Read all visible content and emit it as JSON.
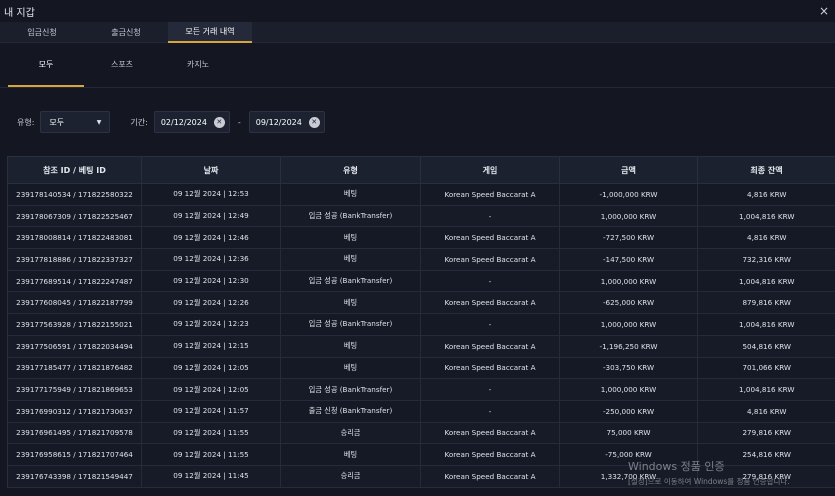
{
  "window": {
    "title": "내 지갑",
    "close": "×"
  },
  "top_tabs": [
    {
      "label": "입금신청"
    },
    {
      "label": "출금신청"
    },
    {
      "label": "모든 거래 내역"
    }
  ],
  "sub_tabs": [
    {
      "label": "모두"
    },
    {
      "label": "스포츠"
    },
    {
      "label": "카지노"
    }
  ],
  "filters": {
    "type_label": "유형:",
    "type_value": "모두",
    "period_label": "기간:",
    "date_from": "02/12/2024",
    "date_to": "09/12/2024",
    "dash": "-"
  },
  "table": {
    "columns": [
      "참조 ID / 베팅 ID",
      "날짜",
      "유형",
      "게임",
      "금액",
      "최종 잔액"
    ],
    "rows": [
      [
        "239178140534 / 171822580322",
        "09 12월 2024 | 12:53",
        "베팅",
        "Korean Speed Baccarat A",
        "-1,000,000 KRW",
        "4,816 KRW"
      ],
      [
        "239178067309 / 171822525467",
        "09 12월 2024 | 12:49",
        "입금 성공 (BankTransfer)",
        "-",
        "1,000,000 KRW",
        "1,004,816 KRW"
      ],
      [
        "239178008814 / 171822483081",
        "09 12월 2024 | 12:46",
        "베팅",
        "Korean Speed Baccarat A",
        "-727,500 KRW",
        "4,816 KRW"
      ],
      [
        "239177818886 / 171822337327",
        "09 12월 2024 | 12:36",
        "베팅",
        "Korean Speed Baccarat A",
        "-147,500 KRW",
        "732,316 KRW"
      ],
      [
        "239177689514 / 171822247487",
        "09 12월 2024 | 12:30",
        "입금 성공 (BankTransfer)",
        "-",
        "1,000,000 KRW",
        "1,004,816 KRW"
      ],
      [
        "239177608045 / 171822187799",
        "09 12월 2024 | 12:26",
        "베팅",
        "Korean Speed Baccarat A",
        "-625,000 KRW",
        "879,816 KRW"
      ],
      [
        "239177563928 / 171822155021",
        "09 12월 2024 | 12:23",
        "입금 성공 (BankTransfer)",
        "-",
        "1,000,000 KRW",
        "1,004,816 KRW"
      ],
      [
        "239177506591 / 171822034494",
        "09 12월 2024 | 12:15",
        "베팅",
        "Korean Speed Baccarat A",
        "-1,196,250 KRW",
        "504,816 KRW"
      ],
      [
        "239177185477 / 171821876482",
        "09 12월 2024 | 12:05",
        "베팅",
        "Korean Speed Baccarat A",
        "-303,750 KRW",
        "701,066 KRW"
      ],
      [
        "239177175949 / 171821869653",
        "09 12월 2024 | 12:05",
        "입금 성공 (BankTransfer)",
        "-",
        "1,000,000 KRW",
        "1,004,816 KRW"
      ],
      [
        "239176990312 / 171821730637",
        "09 12월 2024 | 11:57",
        "출금 신청 (BankTransfer)",
        "-",
        "-250,000 KRW",
        "4,816 KRW"
      ],
      [
        "239176961495 / 171821709578",
        "09 12월 2024 | 11:55",
        "승리금",
        "Korean Speed Baccarat A",
        "75,000 KRW",
        "279,816 KRW"
      ],
      [
        "239176958615 / 171821707464",
        "09 12월 2024 | 11:55",
        "베팅",
        "Korean Speed Baccarat A",
        "-75,000 KRW",
        "254,816 KRW"
      ],
      [
        "239176743398 / 171821549447",
        "09 12월 2024 | 11:45",
        "승리금",
        "Korean Speed Baccarat A",
        "1,332,700 KRW",
        "279,816 KRW"
      ]
    ]
  },
  "watermark": {
    "line1": "Windows 정품 인증",
    "line2": "[설정]으로 이동하여 Windows를 정품 인증합니다."
  }
}
